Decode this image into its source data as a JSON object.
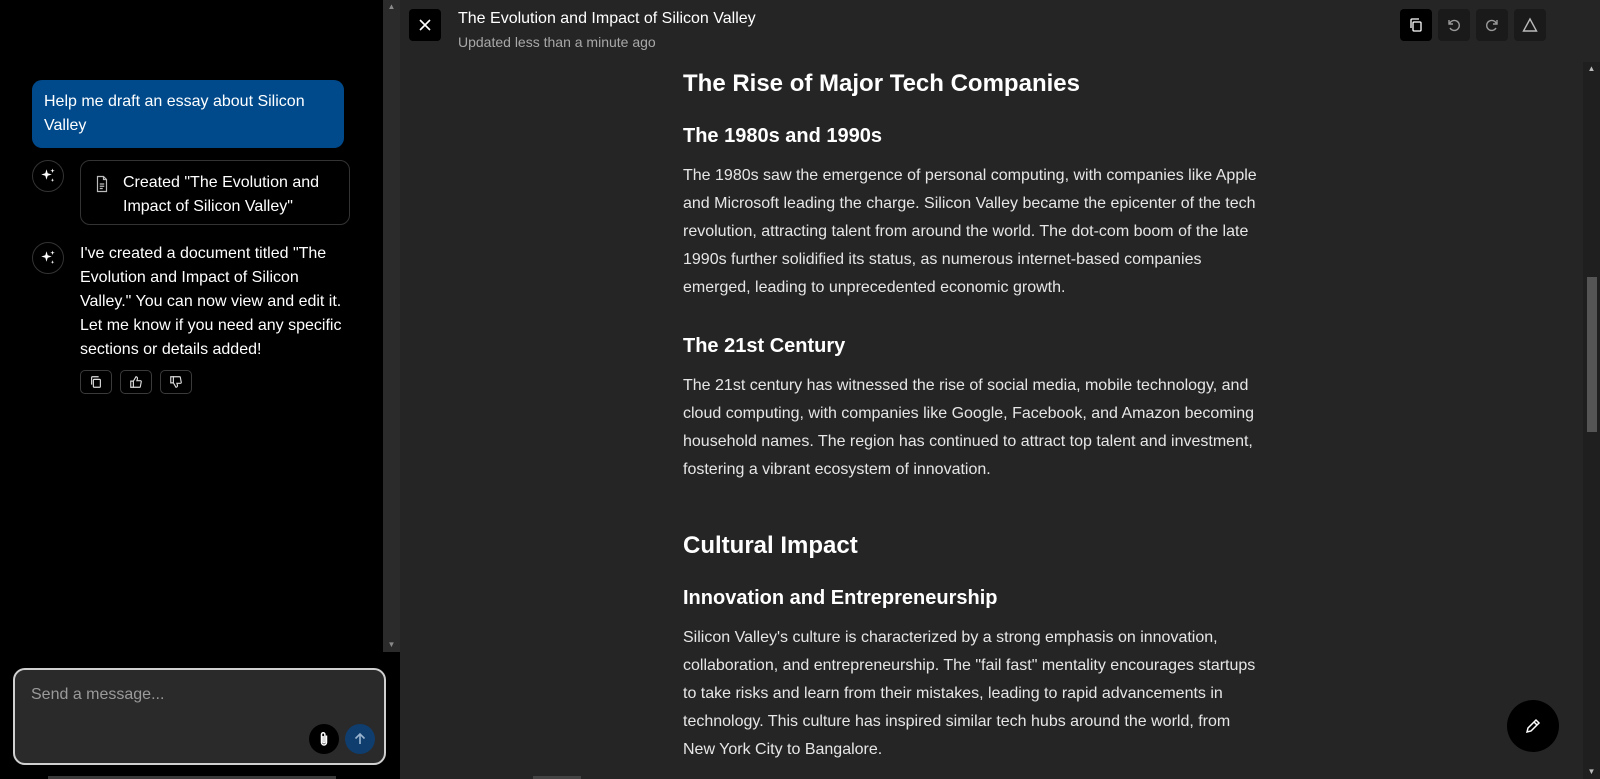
{
  "chat": {
    "user_message": "Help me draft an essay about Silicon Valley",
    "doc_card_label": "Created \"The Evolution and Impact of Silicon Valley\"",
    "assistant_message": "I've created a document titled \"The Evolution and Impact of Silicon Valley.\" You can now view and edit it. Let me know if you need any specific sections or details added!",
    "actions": [
      "copy-icon",
      "thumbs-up-icon",
      "thumbs-down-icon"
    ],
    "composer_placeholder": "Send a message...",
    "accent_color": "#004a8c"
  },
  "document": {
    "title": "The Evolution and Impact of Silicon Valley",
    "subtitle": "Updated less than a minute ago",
    "toolbar": [
      "copy-icon",
      "undo-icon",
      "redo-icon",
      "warning-icon"
    ],
    "sections": {
      "h1_rise": "The Rise of Major Tech Companies",
      "h2_80s": "The 1980s and 1990s",
      "p_80s": "The 1980s saw the emergence of personal computing, with companies like Apple and Microsoft leading the charge. Silicon Valley became the epicenter of the tech revolution, attracting talent from around the world. The dot-com boom of the late 1990s further solidified its status, as numerous internet-based companies emerged, leading to unprecedented economic growth.",
      "h2_21st": "The 21st Century",
      "p_21st": "The 21st century has witnessed the rise of social media, mobile technology, and cloud computing, with companies like Google, Facebook, and Amazon becoming household names. The region has continued to attract top talent and investment, fostering a vibrant ecosystem of innovation.",
      "h1_culture": "Cultural Impact",
      "h2_innovation": "Innovation and Entrepreneurship",
      "p_innovation": "Silicon Valley's culture is characterized by a strong emphasis on innovation, collaboration, and entrepreneurship. The \"fail fast\" mentality encourages startups to take risks and learn from their mistakes, leading to rapid advancements in technology. This culture has inspired similar tech hubs around the world, from New York City to Bangalore."
    }
  }
}
